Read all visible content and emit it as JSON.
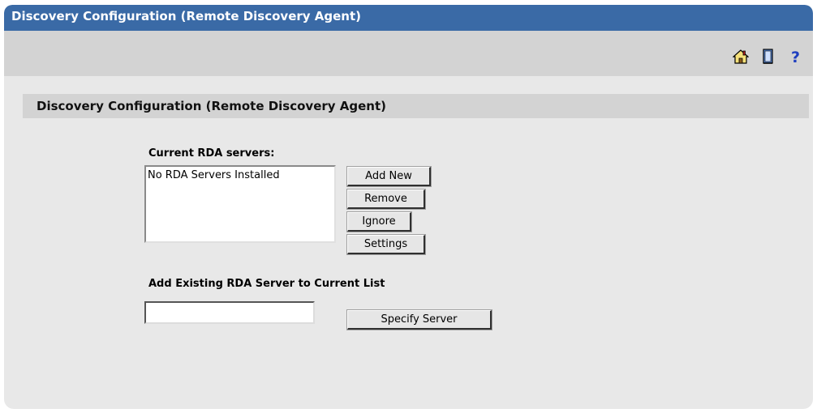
{
  "window": {
    "title": "Discovery Configuration (Remote Discovery Agent)"
  },
  "toolbar": {
    "icons": [
      "home-icon",
      "book-icon",
      "help-icon"
    ]
  },
  "section": {
    "heading": "Discovery Configuration (Remote Discovery Agent)"
  },
  "rda": {
    "current_label": "Current RDA servers:",
    "list_items": [
      "No RDA Servers Installed"
    ],
    "buttons": {
      "add_new": "Add New",
      "remove": "Remove",
      "ignore": "Ignore",
      "settings": "Settings"
    }
  },
  "add_existing": {
    "label": "Add Existing RDA Server to Current List",
    "input_value": "",
    "specify_button": "Specify Server"
  },
  "colors": {
    "titlebar": "#3a6aa6",
    "panel": "#e8e8e8",
    "header": "#d3d3d3",
    "help": "#1f3fbf"
  }
}
